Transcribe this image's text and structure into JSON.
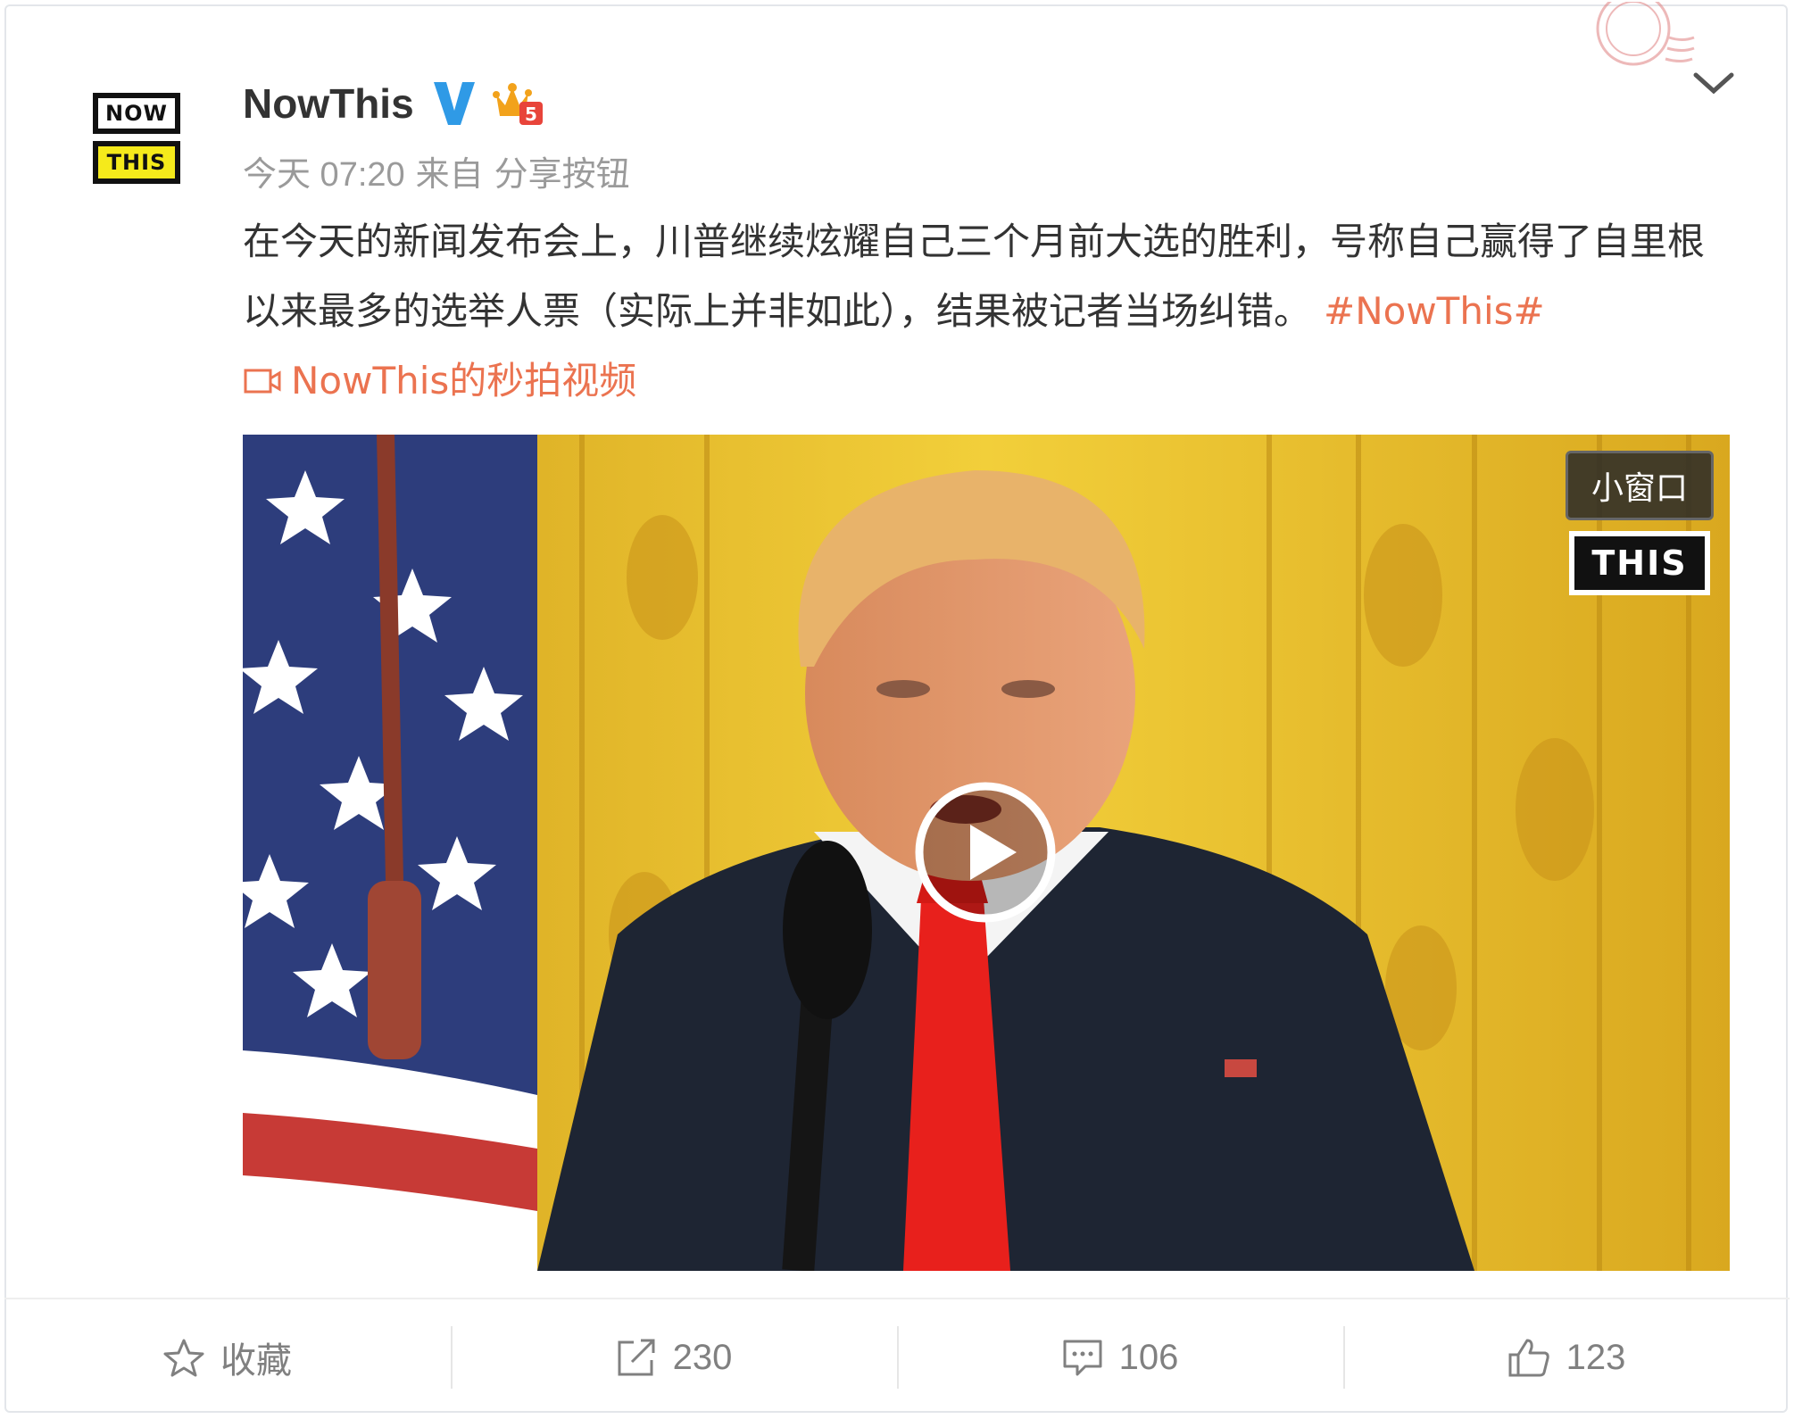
{
  "user": {
    "name": "NowThis",
    "avatar_top": "NOW",
    "avatar_bottom": "THIS",
    "verified_icon": "verified-v-icon",
    "member_icon": "vip-crown-icon"
  },
  "meta": {
    "time": "今天 07:20",
    "source_prefix": "来自",
    "source": "分享按钮"
  },
  "post": {
    "text": "在今天的新闻发布会上，川普继续炫耀自己三个月前大选的胜利，号称自己赢得了自里根以来最多的选举人票（实际上并非如此），结果被记者当场纠错。",
    "hashtag": "#NowThis#",
    "video_link": "NowThis的秒拍视频"
  },
  "video": {
    "small_window_label": "小窗口",
    "watermark": "THIS"
  },
  "actions": {
    "favorite": {
      "label": "收藏",
      "icon": "star-icon"
    },
    "repost": {
      "label": "230",
      "icon": "share-icon"
    },
    "comment": {
      "label": "106",
      "icon": "comment-icon"
    },
    "like": {
      "label": "123",
      "icon": "thumbs-up-icon"
    }
  },
  "colors": {
    "accent": "#eb7350",
    "verified": "#2f9ae6",
    "muted": "#9a9a9a"
  }
}
